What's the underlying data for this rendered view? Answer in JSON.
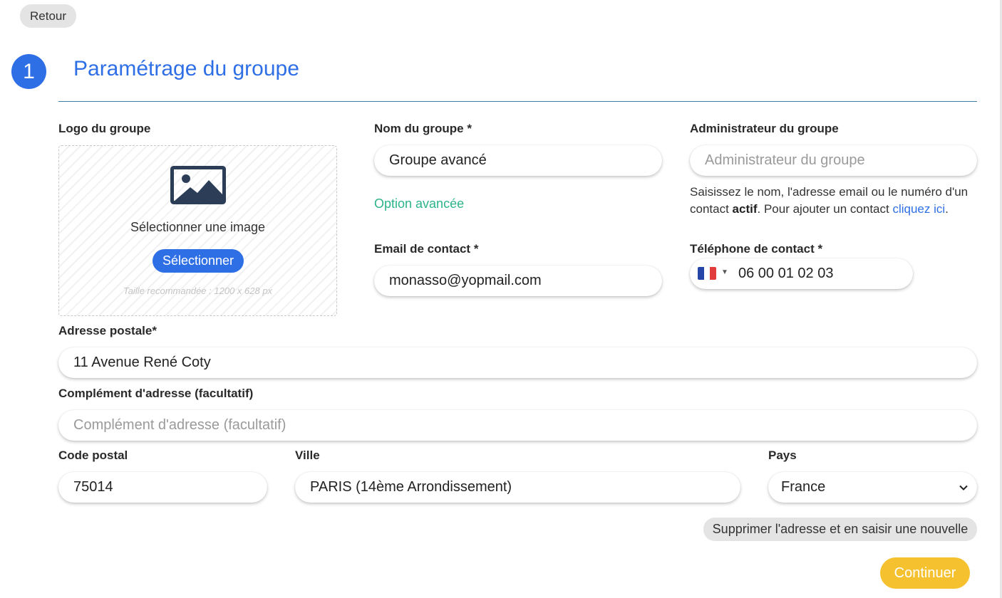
{
  "back_label": "Retour",
  "step": {
    "number": "1",
    "title": "Paramétrage du groupe"
  },
  "logo": {
    "label": "Logo du groupe",
    "select_text": "Sélectionner une image",
    "button_label": "Sélectionner",
    "hint": "Taille recommandée : 1200 x 628 px",
    "icon": "image-icon"
  },
  "group_name": {
    "label": "Nom du groupe *",
    "value": "Groupe avancé"
  },
  "advanced_option": "Option avancée",
  "admin": {
    "label": "Administrateur du groupe",
    "placeholder": "Administrateur du groupe",
    "help_before": "Saisissez le nom, l'adresse email ou le numéro d'un contact ",
    "help_bold": "actif",
    "help_after": ". Pour ajouter un contact ",
    "help_link": "cliquez ici",
    "help_end": "."
  },
  "email": {
    "label": "Email de contact *",
    "value": "monasso@yopmail.com"
  },
  "phone": {
    "label": "Téléphone de contact *",
    "value": "06 00 01 02 03",
    "country_flag": "france-flag-icon"
  },
  "address": {
    "label": "Adresse postale*",
    "value": "11 Avenue René Coty"
  },
  "address_complement": {
    "label": "Complément d'adresse (facultatif)",
    "placeholder": "Complément d'adresse (facultatif)"
  },
  "postal_code": {
    "label": "Code postal",
    "value": "75014"
  },
  "city": {
    "label": "Ville",
    "value": "PARIS (14ème Arrondissement)"
  },
  "country": {
    "label": "Pays",
    "value": "France"
  },
  "delete_address_label": "Supprimer l'adresse et en saisir une nouvelle",
  "continue_label": "Continuer",
  "colors": {
    "primary": "#2f6fe6",
    "accent_green": "#2cb38a",
    "continue_yellow": "#f5c12e",
    "rule": "#3a7ea4"
  }
}
